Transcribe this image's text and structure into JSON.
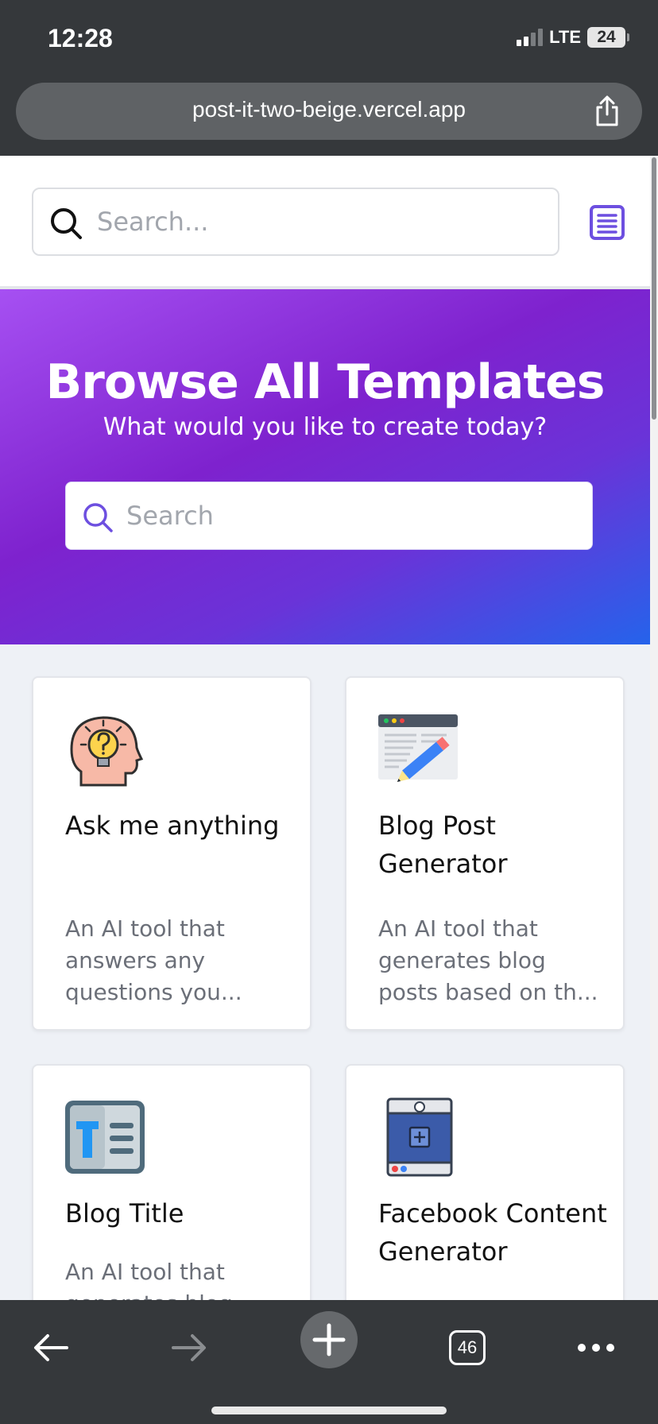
{
  "status_bar": {
    "time": "12:28",
    "network": "LTE",
    "battery": "24"
  },
  "browser": {
    "url": "post-it-two-beige.vercel.app",
    "share_icon": "share-icon",
    "tabs_count": "46"
  },
  "header": {
    "search_placeholder": "Search...",
    "menu_icon": "menu-icon"
  },
  "hero": {
    "title": "Browse All Templates",
    "subtitle": "What would you like to create today?",
    "search_placeholder": "Search"
  },
  "templates": [
    {
      "title": "Ask me anything",
      "description": "An AI tool that answers any questions you...",
      "icon": "head-lightbulb-icon"
    },
    {
      "title": "Blog Post Generator",
      "description": "An AI tool that generates blog posts based on th...",
      "icon": "blog-post-pencil-icon"
    },
    {
      "title": "Blog Title",
      "description": "An AI tool that generates blog",
      "icon": "text-document-icon"
    },
    {
      "title": "Facebook Content Generator",
      "description": "",
      "icon": "facebook-post-icon"
    }
  ],
  "colors": {
    "accent": "#6d4fe0",
    "hero_gradient_start": "#a650f2",
    "hero_gradient_mid": "#7e22ce",
    "hero_gradient_end": "#2563eb",
    "browser_chrome": "#35383b"
  }
}
